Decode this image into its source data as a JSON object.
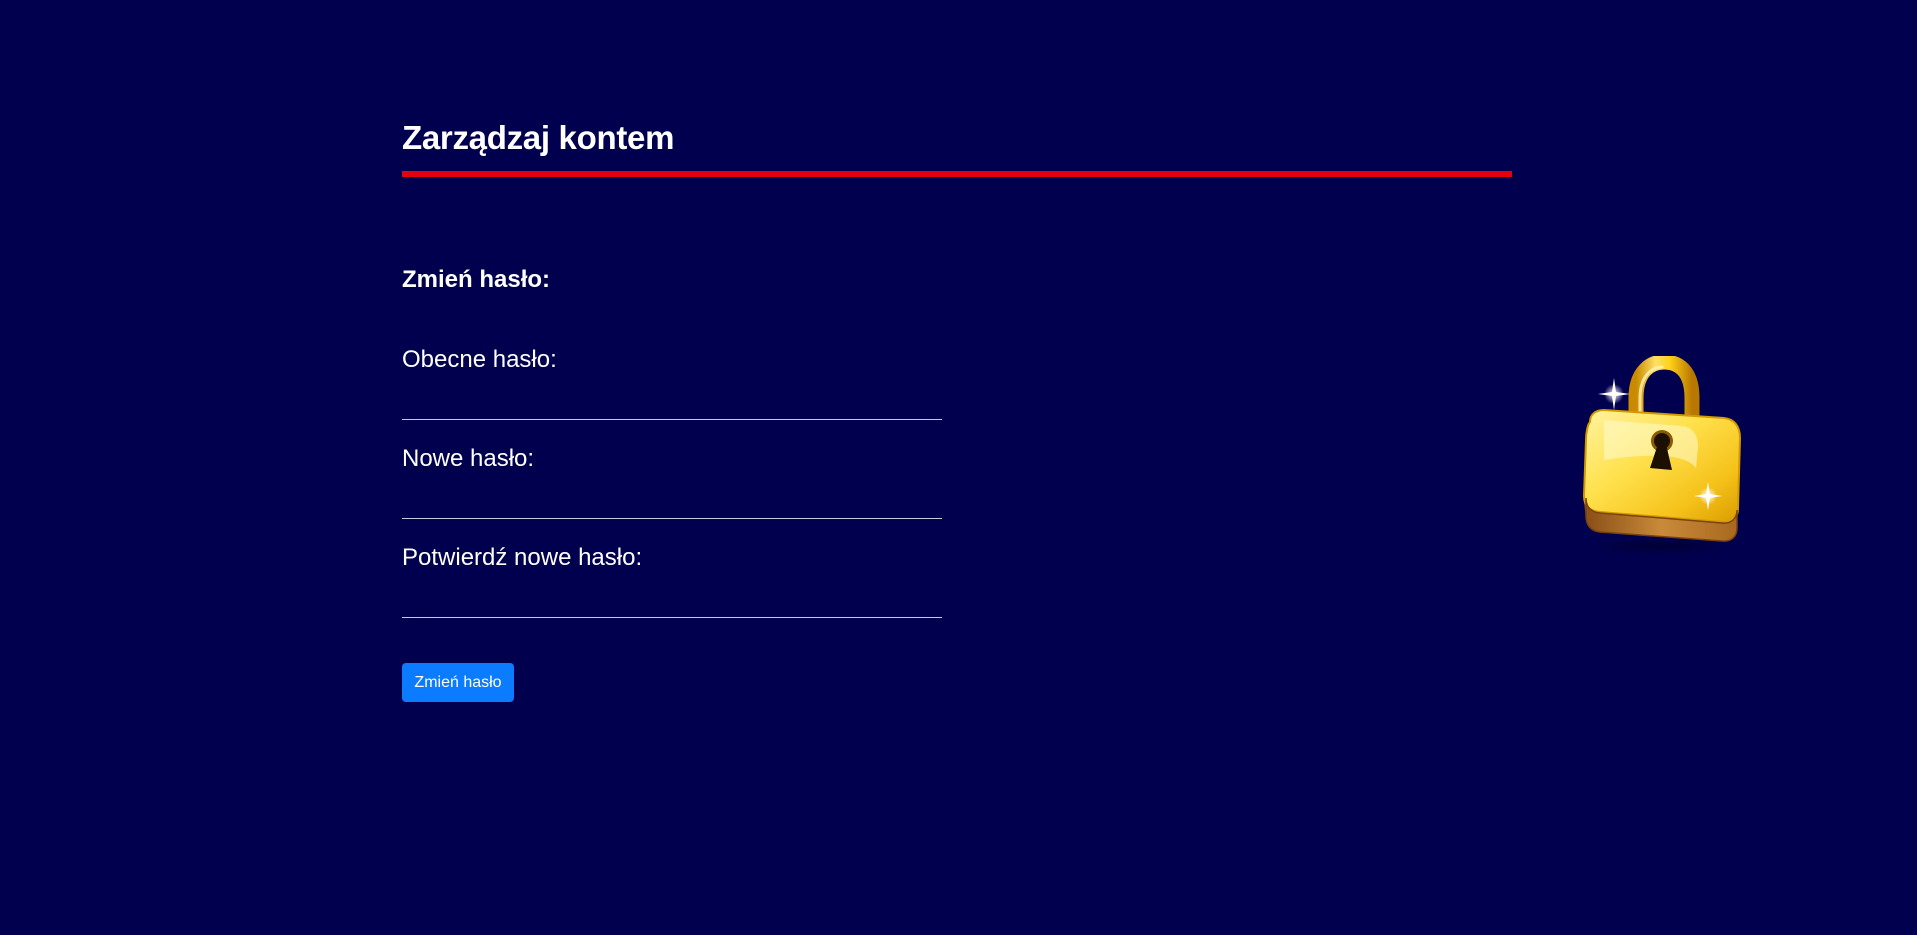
{
  "header": {
    "title": "Zarządzaj kontem"
  },
  "form": {
    "section_title": "Zmień hasło:",
    "fields": [
      {
        "label": "Obecne hasło:",
        "value": "",
        "placeholder": ""
      },
      {
        "label": "Nowe hasło:",
        "value": "",
        "placeholder": ""
      },
      {
        "label": "Potwierdź nowe hasło:",
        "value": "",
        "placeholder": ""
      }
    ],
    "submit_label": "Zmień hasło"
  },
  "illustration": {
    "icon": "padlock-icon"
  },
  "colors": {
    "background": "#01004e",
    "accent_rule": "#e3000f",
    "button": "#0b7bff",
    "text": "#ffffff"
  }
}
